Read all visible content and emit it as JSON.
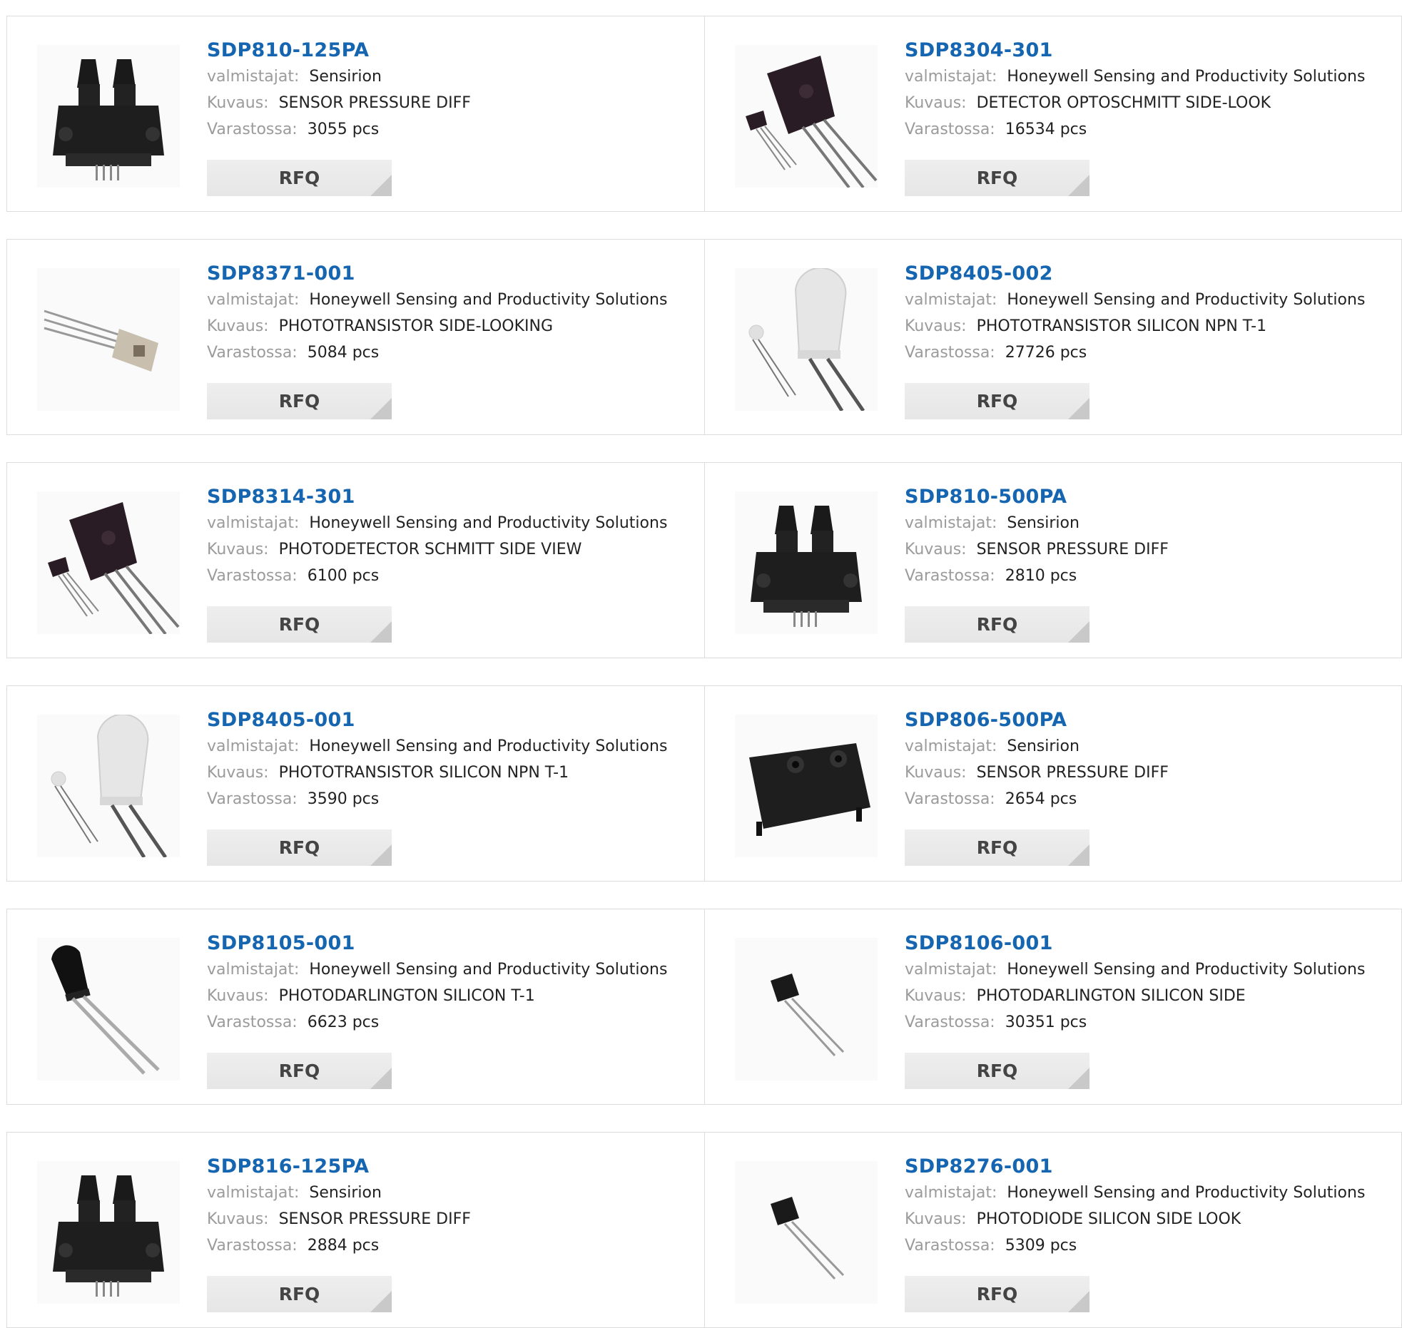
{
  "labels": {
    "manufacturer": "valmistajat:",
    "description": "Kuvaus:",
    "stock": "Varastossa:",
    "rfq": "RFQ"
  },
  "colors": {
    "title": "#1565b0",
    "label": "#9b9b9b",
    "value": "#222222",
    "button_bg": "#eeeeee",
    "border": "#dcdcdc"
  },
  "products": [
    {
      "part": "SDP810-125PA",
      "manufacturer": "Sensirion",
      "description": "SENSOR PRESSURE DIFF",
      "stock": "3055 pcs",
      "image_icon": "pressure-sensor-icon"
    },
    {
      "part": "SDP8304-301",
      "manufacturer": "Honeywell Sensing and Productivity Solutions",
      "description": "DETECTOR OPTOSCHMITT SIDE-LOOK",
      "stock": "16534 pcs",
      "image_icon": "side-look-detector-icon"
    },
    {
      "part": "SDP8371-001",
      "manufacturer": "Honeywell Sensing and Productivity Solutions",
      "description": "PHOTOTRANSISTOR SIDE-LOOKING",
      "stock": "5084 pcs",
      "image_icon": "phototransistor-sidelook-icon"
    },
    {
      "part": "SDP8405-002",
      "manufacturer": "Honeywell Sensing and Productivity Solutions",
      "description": "PHOTOTRANSISTOR SILICON NPN T-1",
      "stock": "27726 pcs",
      "image_icon": "clear-led-icon"
    },
    {
      "part": "SDP8314-301",
      "manufacturer": "Honeywell Sensing and Productivity Solutions",
      "description": "PHOTODETECTOR SCHMITT SIDE VIEW",
      "stock": "6100 pcs",
      "image_icon": "side-look-detector-icon"
    },
    {
      "part": "SDP810-500PA",
      "manufacturer": "Sensirion",
      "description": "SENSOR PRESSURE DIFF",
      "stock": "2810 pcs",
      "image_icon": "pressure-sensor-icon"
    },
    {
      "part": "SDP8405-001",
      "manufacturer": "Honeywell Sensing and Productivity Solutions",
      "description": "PHOTOTRANSISTOR SILICON NPN T-1",
      "stock": "3590 pcs",
      "image_icon": "clear-led-icon"
    },
    {
      "part": "SDP806-500PA",
      "manufacturer": "Sensirion",
      "description": "SENSOR PRESSURE DIFF",
      "stock": "2654 pcs",
      "image_icon": "flat-pressure-sensor-icon"
    },
    {
      "part": "SDP8105-001",
      "manufacturer": "Honeywell Sensing and Productivity Solutions",
      "description": "PHOTODARLINGTON SILICON T-1",
      "stock": "6623 pcs",
      "image_icon": "black-led-icon"
    },
    {
      "part": "SDP8106-001",
      "manufacturer": "Honeywell Sensing and Productivity Solutions",
      "description": "PHOTODARLINGTON SILICON SIDE",
      "stock": "30351 pcs",
      "image_icon": "small-side-component-icon"
    },
    {
      "part": "SDP816-125PA",
      "manufacturer": "Sensirion",
      "description": "SENSOR PRESSURE DIFF",
      "stock": "2884 pcs",
      "image_icon": "pressure-sensor-icon"
    },
    {
      "part": "SDP8276-001",
      "manufacturer": "Honeywell Sensing and Productivity Solutions",
      "description": "PHOTODIODE SILICON SIDE LOOK",
      "stock": "5309 pcs",
      "image_icon": "small-side-component-icon"
    }
  ]
}
